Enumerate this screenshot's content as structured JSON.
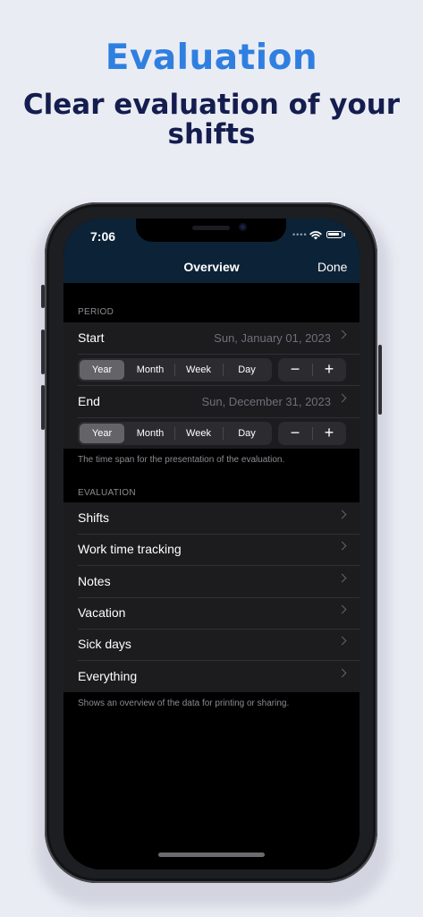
{
  "promo": {
    "title": "Evaluation",
    "subtitle_line1": "Clear evaluation of your",
    "subtitle_line2": "shifts"
  },
  "status_bar": {
    "time": "7:06",
    "signal": "••••"
  },
  "nav": {
    "title": "Overview",
    "done_label": "Done"
  },
  "period": {
    "header": "PERIOD",
    "start": {
      "label": "Start",
      "value": "Sun, January 01, 2023",
      "segments": [
        "Year",
        "Month",
        "Week",
        "Day"
      ],
      "selected": "Year"
    },
    "end": {
      "label": "End",
      "value": "Sun, December 31, 2023",
      "segments": [
        "Year",
        "Month",
        "Week",
        "Day"
      ],
      "selected": "Year"
    },
    "stepper": {
      "minus": "−",
      "plus": "+"
    },
    "footnote": "The time span for the presentation of the evaluation."
  },
  "evaluation": {
    "header": "EVALUATION",
    "items": [
      "Shifts",
      "Work time tracking",
      "Notes",
      "Vacation",
      "Sick days",
      "Everything"
    ],
    "footnote": "Shows an overview of the data for printing or sharing."
  },
  "colors": {
    "accent": "#2f7fe0",
    "headline": "#141d4e",
    "nav_bar": "#0c2236"
  }
}
